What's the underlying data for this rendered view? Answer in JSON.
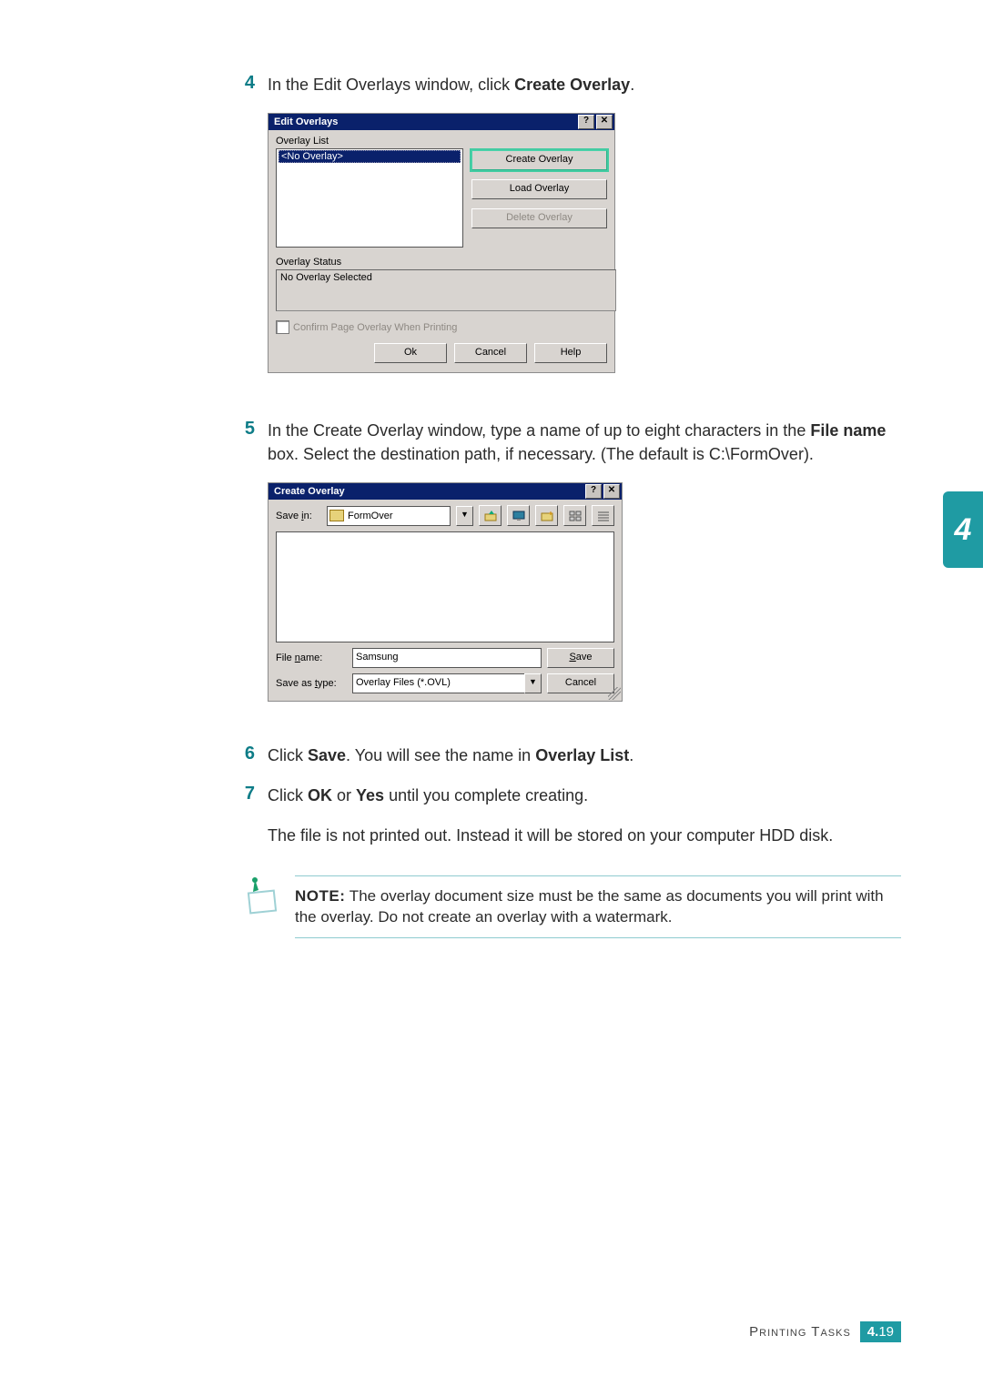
{
  "side_tab": "4",
  "steps": {
    "s4": {
      "num": "4",
      "text_a": "In the Edit Overlays window, click ",
      "bold": "Create Overlay",
      "text_b": "."
    },
    "s5": {
      "num": "5",
      "text_a": "In the Create Overlay window, type a name of up to eight characters in the ",
      "bold1": "File name",
      "text_b": " box. Select the destination path, if necessary. (The default is C:\\FormOver)."
    },
    "s6": {
      "num": "6",
      "text_a": "Click ",
      "bold1": "Save",
      "text_b": ". You will see the name in ",
      "bold2": "Overlay List",
      "text_c": "."
    },
    "s7": {
      "num": "7",
      "text_a": "Click ",
      "bold1": "OK",
      "text_b": " or ",
      "bold2": "Yes",
      "text_c": " until you complete creating."
    },
    "s7_extra": "The file is not printed out. Instead it will be stored on your computer HDD disk."
  },
  "note": {
    "label": "NOTE:",
    "text": " The overlay document size must be the same as documents you will print with the overlay. Do not create an overlay with a watermark."
  },
  "dlg1": {
    "title": "Edit Overlays",
    "help_btn": "?",
    "close_btn": "✕",
    "list_label": "Overlay List",
    "list_item": "<No Overlay>",
    "btn_create": "Create Overlay",
    "btn_load": "Load Overlay",
    "btn_delete": "Delete Overlay",
    "status_label": "Overlay Status",
    "status_text": "No Overlay Selected",
    "confirm_label": "Confirm Page Overlay When Printing",
    "ok": "Ok",
    "cancel": "Cancel",
    "help": "Help"
  },
  "dlg2": {
    "title": "Create Overlay",
    "help_btn": "?",
    "close_btn": "✕",
    "savein_label_pre": "Save ",
    "savein_label_u": "i",
    "savein_label_post": "n:",
    "folder_name": "FormOver",
    "filename_label_pre": "File ",
    "filename_label_u": "n",
    "filename_label_post": "ame:",
    "filename_value": "Samsung",
    "saveas_label_pre": "Save as ",
    "saveas_label_u": "t",
    "saveas_label_post": "ype:",
    "saveas_value": "Overlay Files (*.OVL)",
    "save_btn_u": "S",
    "save_btn_post": "ave",
    "cancel_btn": "Cancel",
    "drop_glyph": "▼"
  },
  "footer": {
    "label": "Printing Tasks",
    "chapter": "4.",
    "page": "19"
  }
}
